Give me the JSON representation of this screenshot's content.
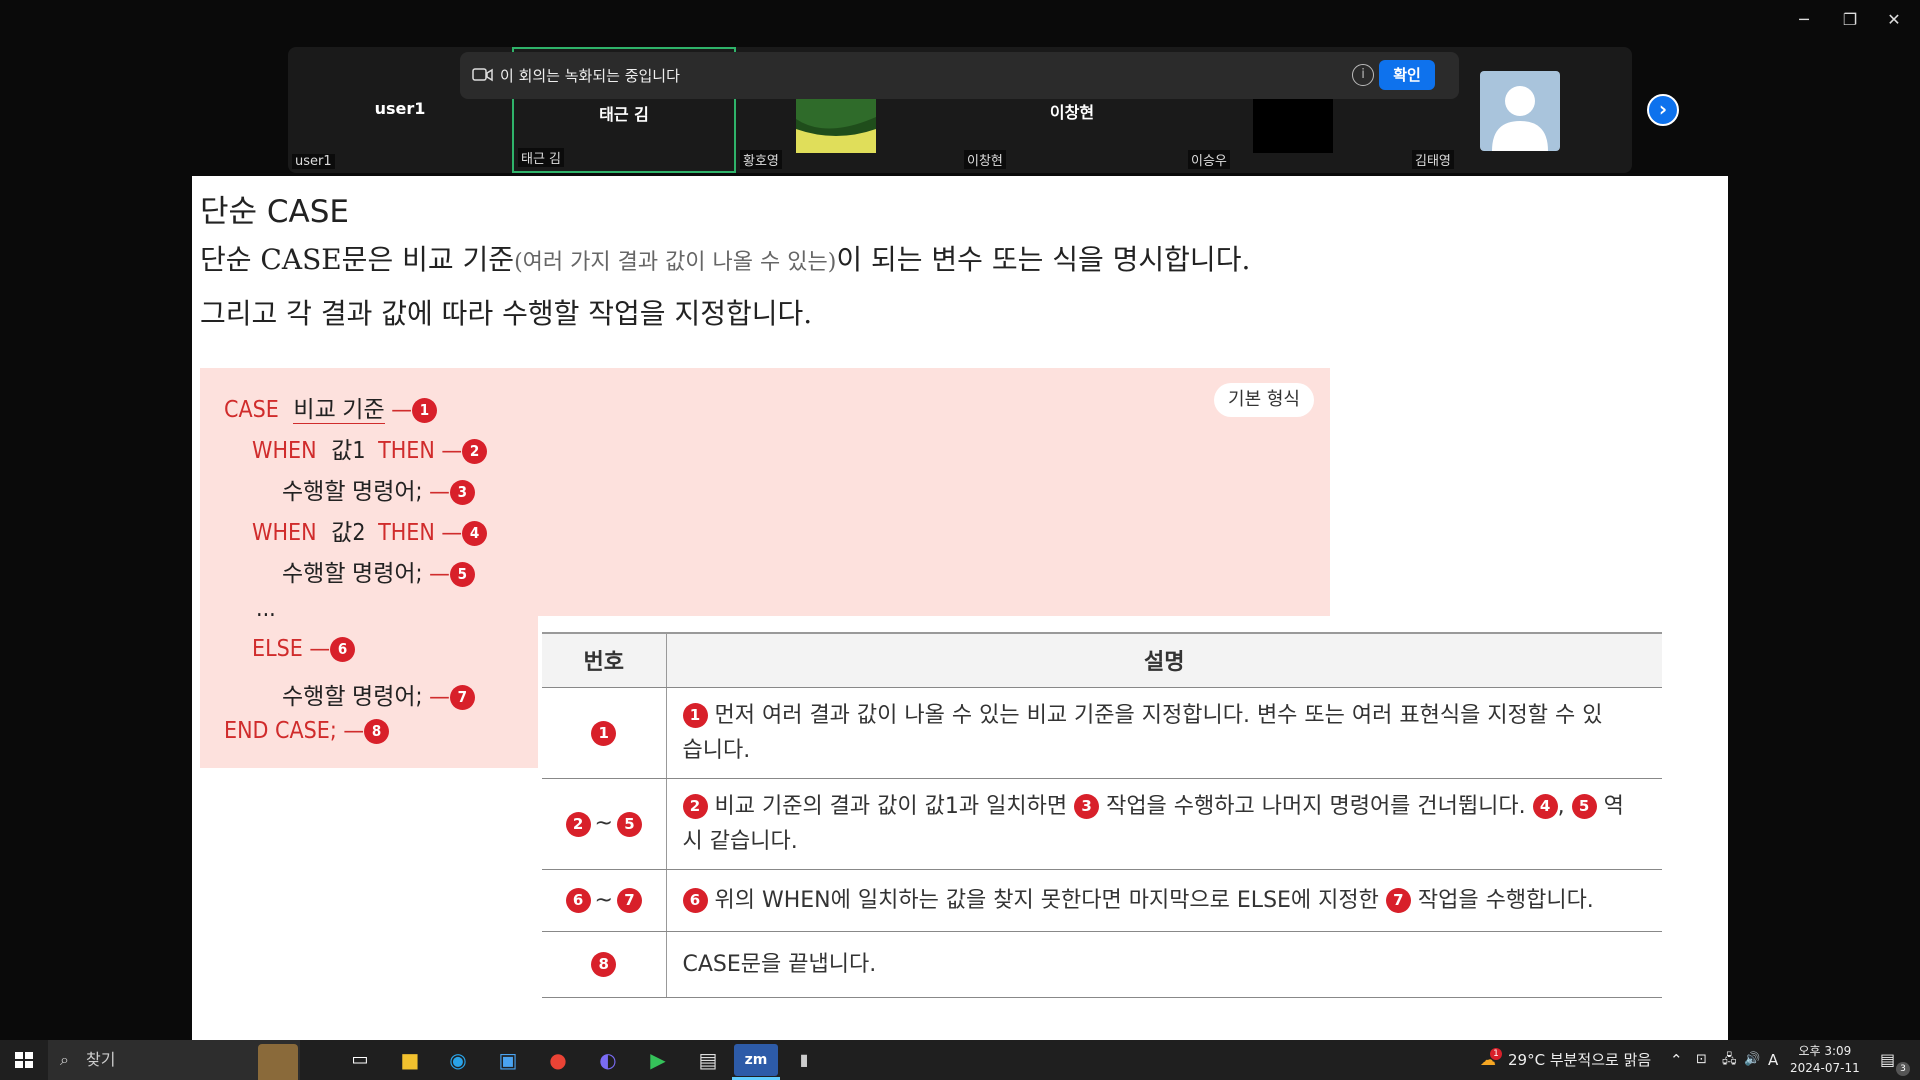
{
  "participants": [
    {
      "name": "user1",
      "label": "user1"
    },
    {
      "name": "태근 김",
      "label": "태근 김"
    },
    {
      "name": "",
      "label": "황호영"
    },
    {
      "name": "이창현",
      "label": "이창현"
    },
    {
      "name": "",
      "label": "이승우"
    },
    {
      "name": "",
      "label": "김태영"
    }
  ],
  "recording_banner": {
    "text": "이 회의는 녹화되는 중입니다",
    "ok_label": "확인"
  },
  "slide": {
    "title": "단순 CASE",
    "line1_main": "단순 CASE문은 비교 기준",
    "line1_paren": "(여러 가지 결과 값이 나올 수 있는)",
    "line1_tail": "이 되는 변수 또는 식을 명시합니다.",
    "line2": "그리고 각 결과 값에 따라 수행할 작업을 지정합니다.",
    "badge": "기본 형식",
    "code": {
      "case_kw": "CASE",
      "case_ref": "비교 기준",
      "when1_kw": "WHEN",
      "val1": "값1",
      "then1_kw": "THEN",
      "stmt1": "수행할 명령어;",
      "when2_kw": "WHEN",
      "val2": "값2",
      "then2_kw": "THEN",
      "stmt2": "수행할 명령어;",
      "ellipsis": "...",
      "else_kw": "ELSE",
      "stmt3": "수행할 명령어;",
      "end_kw": "END CASE;"
    },
    "markers": [
      "1",
      "2",
      "3",
      "4",
      "5",
      "6",
      "7",
      "8"
    ],
    "table": {
      "header_num": "번호",
      "header_desc": "설명",
      "rows": [
        {
          "desc_a": "먼저 여러 결과 값이 나올 수 있는 비교 기준을 지정합니다. 변수 또는 여러 표현식을 지정할 수 있",
          "desc_b": "습니다."
        },
        {
          "desc_a": "비교 기준의 결과 값이 값1과 일치하면",
          "desc_b": "작업을 수행하고 나머지 명령어를 건너뜁니다.",
          "desc_c": "역",
          "desc_d": "시 같습니다."
        },
        {
          "desc_a": "위의 WHEN에 일치하는 값을 찾지 못한다면 마지막으로 ELSE에 지정한",
          "desc_b": "작업을 수행합니다."
        },
        {
          "desc_a": "CASE문을 끝냅니다."
        }
      ]
    }
  },
  "taskbar": {
    "search_placeholder": "찾기",
    "weather": "29°C 부분적으로 맑음",
    "ime": "A",
    "time": "오후 3:09",
    "date": "2024-07-11",
    "notif_count": "3",
    "weather_badge": "1"
  },
  "colors": {
    "accent": "#0e72ed",
    "marker_red": "#d8202a",
    "code_red": "#d02c2c",
    "pink_bg": "#fde1dd",
    "active_speaker": "#2fb36a"
  }
}
